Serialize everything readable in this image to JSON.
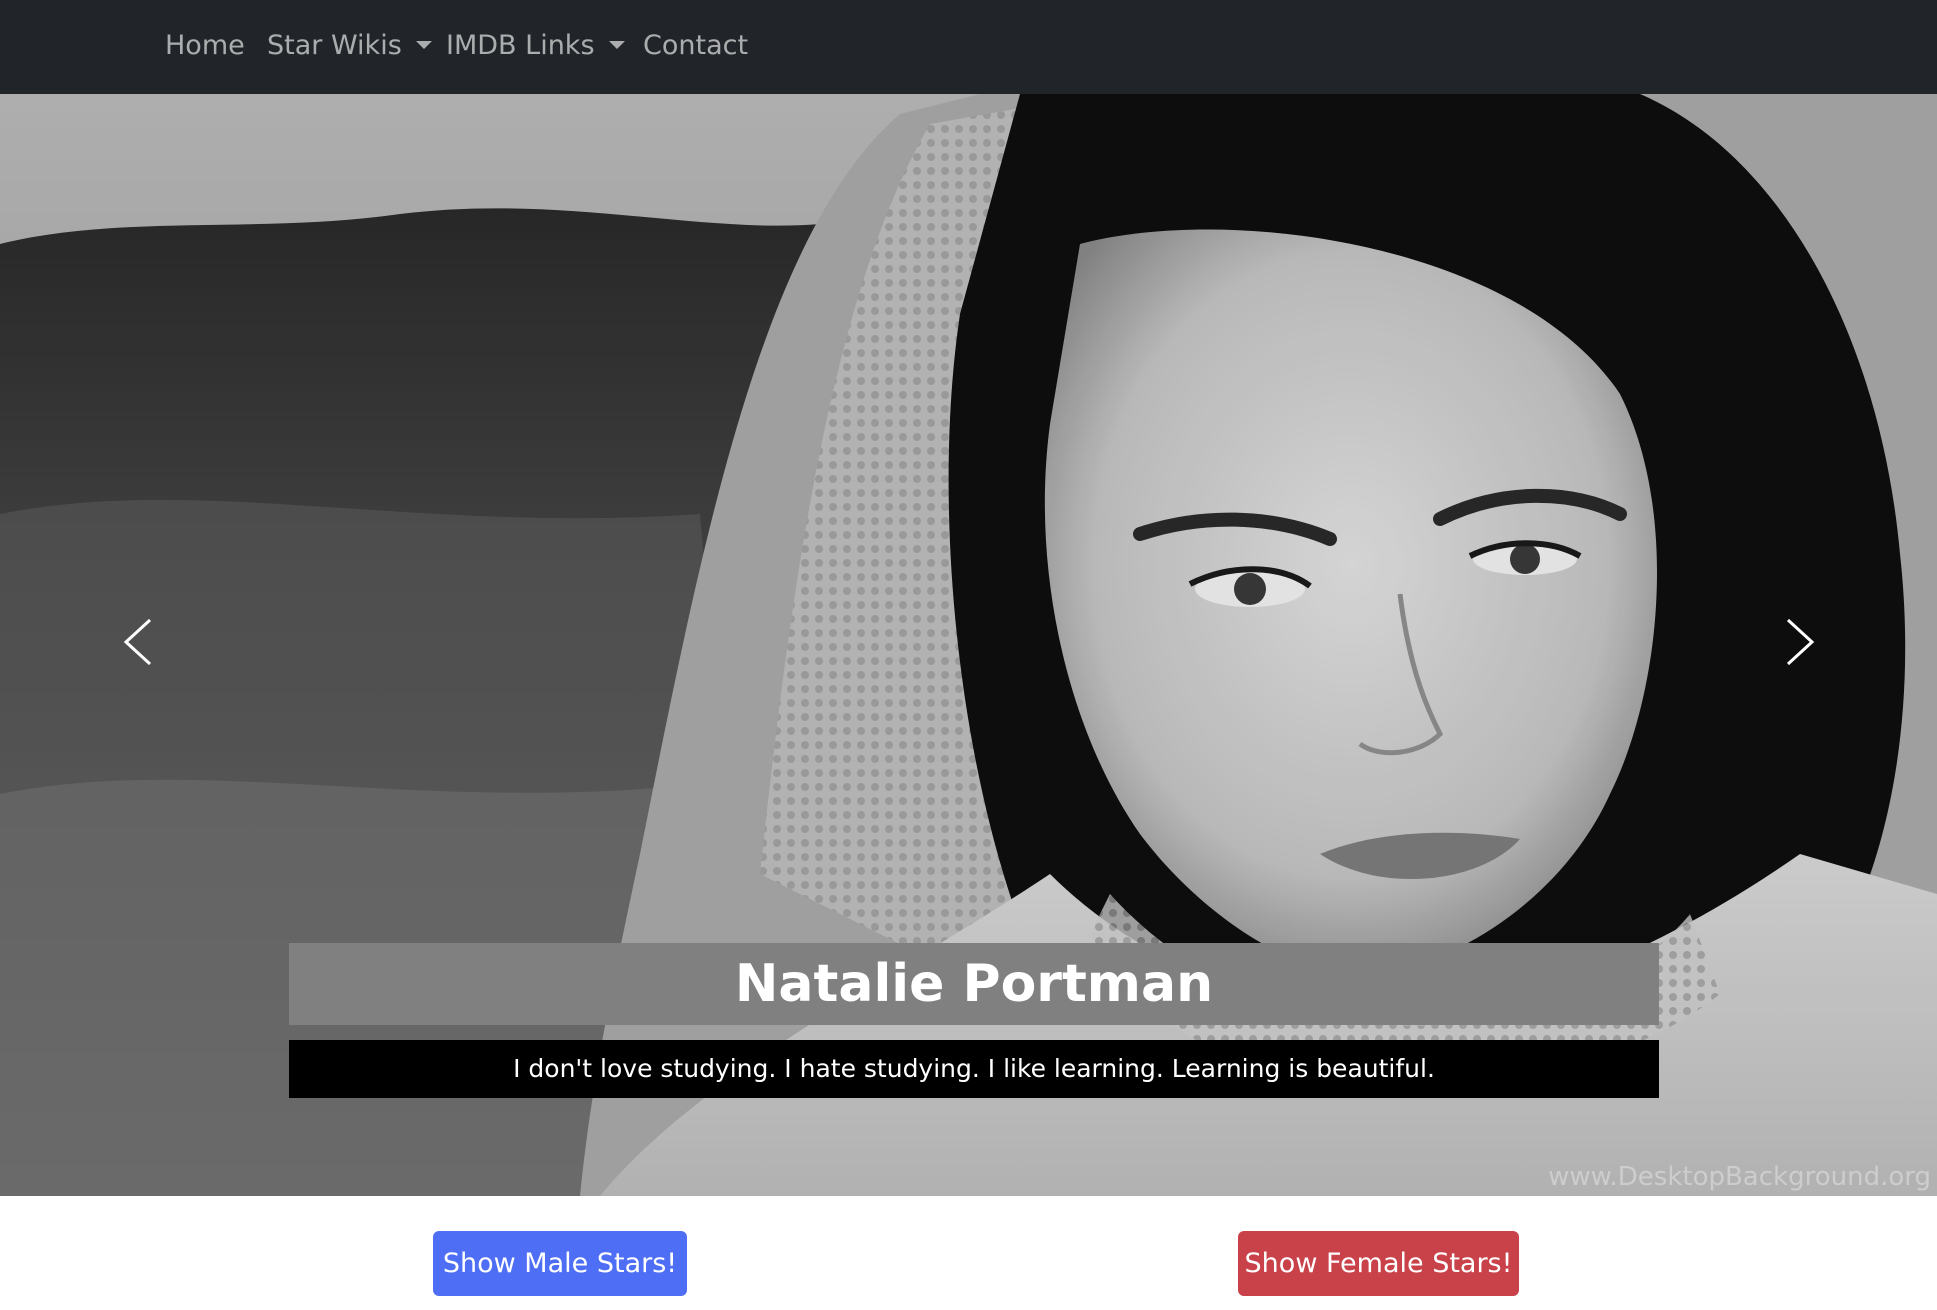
{
  "navbar": {
    "items": [
      {
        "label": "Home",
        "dropdown": false
      },
      {
        "label": "Star Wikis",
        "dropdown": true
      },
      {
        "label": "IMDB Links",
        "dropdown": true
      },
      {
        "label": "Contact",
        "dropdown": false
      }
    ]
  },
  "carousel": {
    "slide": {
      "title": "Natalie Portman",
      "quote": "I don't love studying. I hate studying. I like learning. Learning is beautiful.",
      "watermark": "www.DesktopBackground.org"
    },
    "prev_icon": "chevron-left-icon",
    "next_icon": "chevron-right-icon"
  },
  "buttons": {
    "male_label": "Show Male Stars!",
    "female_label": "Show Female Stars!"
  },
  "colors": {
    "navbar_bg": "#212529",
    "male_button": "#4d6ef5",
    "female_button": "#c9424a",
    "caption_title_bg": "#808080",
    "caption_quote_bg": "#000000"
  }
}
